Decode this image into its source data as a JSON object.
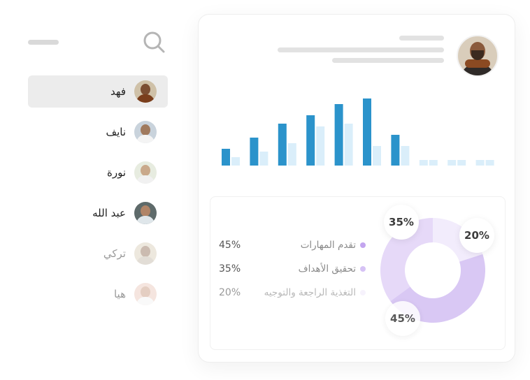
{
  "sidebar": {
    "contacts": [
      {
        "name": "فهد",
        "active": true
      },
      {
        "name": "نايف",
        "active": false
      },
      {
        "name": "نورة",
        "active": false
      },
      {
        "name": "عبد الله",
        "active": false
      },
      {
        "name": "تركي",
        "active": false
      },
      {
        "name": "هيا",
        "active": false
      }
    ]
  },
  "colors": {
    "bar_primary": "#2b93cb",
    "bar_secondary": "#daeefa",
    "donut_1": "#d9c8f4",
    "donut_2": "#e6d9f8",
    "donut_3": "#f2ecfc",
    "legend_dot_1": "#c3a5ef",
    "legend_dot_2": "#d6c2f5",
    "legend_dot_3": "#f1ebfb"
  },
  "chart_data": [
    {
      "type": "bar",
      "series": [
        {
          "values": [
            6,
            10,
            15,
            18,
            22,
            24,
            11,
            2,
            2,
            2
          ]
        },
        {
          "values": [
            3,
            5,
            8,
            14,
            15,
            7,
            7,
            2,
            2,
            2
          ]
        }
      ]
    },
    {
      "type": "pie",
      "labels": [
        "تقدم المهارات",
        "تحقيق الأهداف",
        "التغذية الراجعة والتوجيه"
      ],
      "values": [
        45,
        35,
        20
      ],
      "value_labels": [
        "45%",
        "35%",
        "20%"
      ]
    }
  ]
}
